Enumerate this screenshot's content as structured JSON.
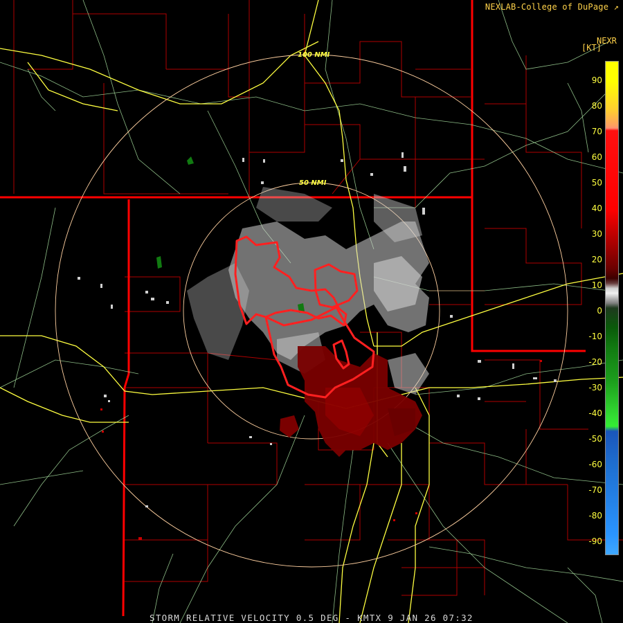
{
  "header": {
    "credit": "NEXLAB-College of DuPage",
    "product_code": "NEXR",
    "unit": "[KT]"
  },
  "footer": {
    "caption": "STORM RELATIVE VELOCITY 0.5 DEG - KMTX 9 JAN 26 07:32"
  },
  "range_rings": {
    "outer_label": "100 NMI",
    "inner_label": "50 NMI"
  },
  "colorbar": {
    "ticks": [
      "90",
      "80",
      "70",
      "60",
      "50",
      "40",
      "30",
      "20",
      "10",
      "0",
      "-10",
      "-20",
      "-30",
      "-40",
      "-50",
      "-60",
      "-70",
      "-80",
      "-90"
    ]
  },
  "colors": {
    "state_border": "#ff0000",
    "county_border": "#b00000",
    "highway": "#ffff40",
    "road": "#a8e0a0",
    "range_ring": "#ffd0a0",
    "inbound_green": "#117a11",
    "outbound_red": "#7a0000",
    "near_zero": "#d0d0d0"
  }
}
